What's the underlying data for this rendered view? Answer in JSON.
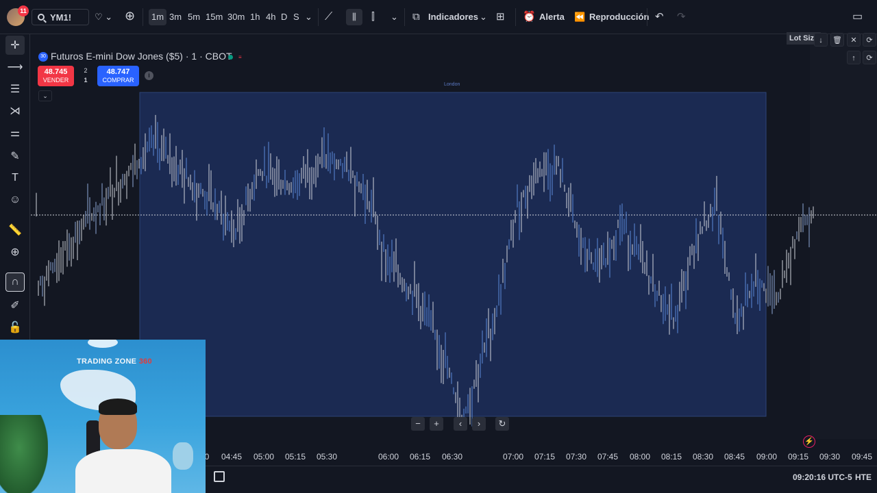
{
  "topbar": {
    "notification_count": "11",
    "symbol": "YM1!",
    "timeframes": [
      "1m",
      "3m",
      "5m",
      "15m",
      "30m",
      "1h",
      "4h",
      "D",
      "S"
    ],
    "active_timeframe": "1m",
    "indicators_label": "Indicadores",
    "alert_label": "Alerta",
    "replay_label": "Reproducción"
  },
  "legend": {
    "badge": "30",
    "title": "Futuros E-mini Dow Jones ($5) · 1 · CBOT",
    "sell_price": "48.745",
    "sell_label": "VENDER",
    "buy_price": "48.747",
    "buy_label": "COMPRAR",
    "spread_top": "2",
    "spread_bottom": "1",
    "session_label": "London"
  },
  "right_panel": {
    "lot_size_label": "Lot Size"
  },
  "time_axis": {
    "ticks": [
      "0",
      "04:45",
      "05:00",
      "05:15",
      "05:30",
      "06:00",
      "06:15",
      "06:30",
      "07:00",
      "07:15",
      "07:30",
      "07:45",
      "08:00",
      "08:15",
      "08:30",
      "08:45",
      "09:00",
      "09:15",
      "09:30",
      "09:45"
    ]
  },
  "bottombar": {
    "clock": "09:20:16 UTC-5",
    "session": "HTE"
  },
  "webcam": {
    "logo_text": "TRADING ZONE",
    "logo_accent": "360"
  },
  "colors": {
    "background": "#131722",
    "session_box": "#1b2a52",
    "bar": "#d1d4dc",
    "bar_blue": "#5b8bd9",
    "sell": "#f23645",
    "buy": "#2962ff"
  }
}
